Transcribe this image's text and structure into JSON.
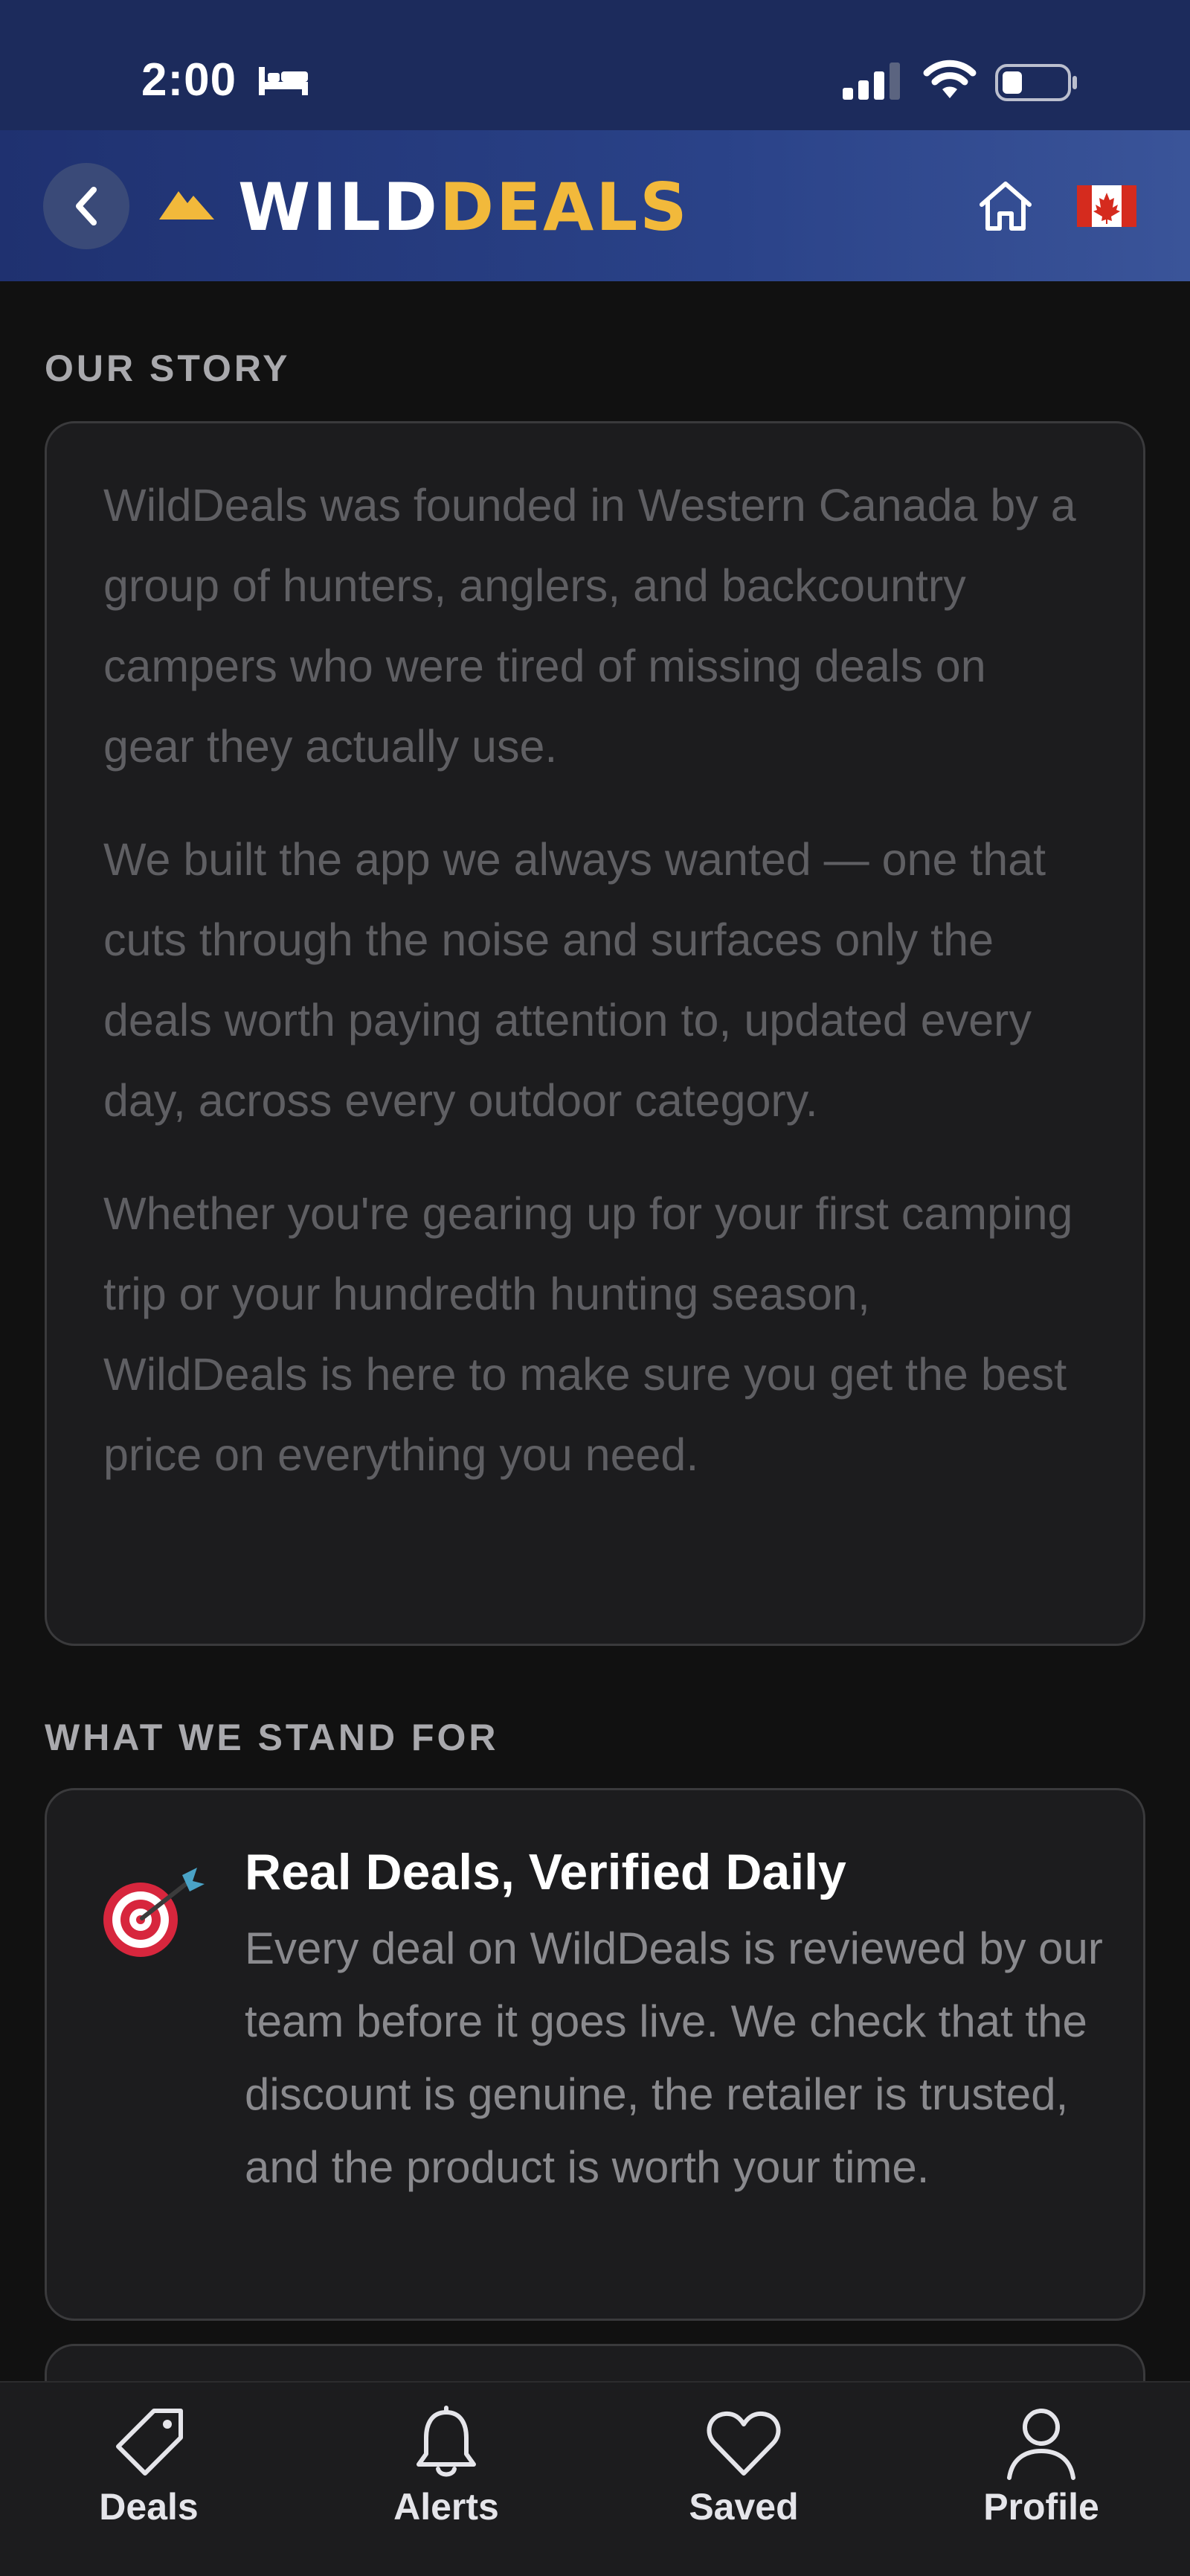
{
  "status_bar": {
    "time": "2:00"
  },
  "header": {
    "logo_wild": "WILD",
    "logo_deals": "DEALS",
    "accent_color": "#f2b93b"
  },
  "story": {
    "section_title": "OUR STORY",
    "paragraphs": [
      "WildDeals was founded in Western Canada by a group of hunters, anglers, and backcountry campers who were tired of missing deals on gear they actually use.",
      "We built the app we always wanted — one that cuts through the noise and surfaces only the deals worth paying attention to, updated every day, across every outdoor category.",
      "Whether you're gearing up for your first camping trip or your hundredth hunting season, WildDeals is here to make sure you get the best price on everything you need."
    ]
  },
  "values": {
    "section_title": "WHAT WE STAND FOR",
    "items": [
      {
        "icon": "target-icon",
        "title": "Real Deals, Verified Daily",
        "description": "Every deal on WildDeals is reviewed by our team before it goes live. We check that the discount is genuine, the retailer is trusted, and the product is worth your time."
      }
    ]
  },
  "tabs": [
    {
      "label": "Deals",
      "icon": "tag-icon"
    },
    {
      "label": "Alerts",
      "icon": "bell-icon"
    },
    {
      "label": "Saved",
      "icon": "heart-icon"
    },
    {
      "label": "Profile",
      "icon": "person-icon"
    }
  ]
}
